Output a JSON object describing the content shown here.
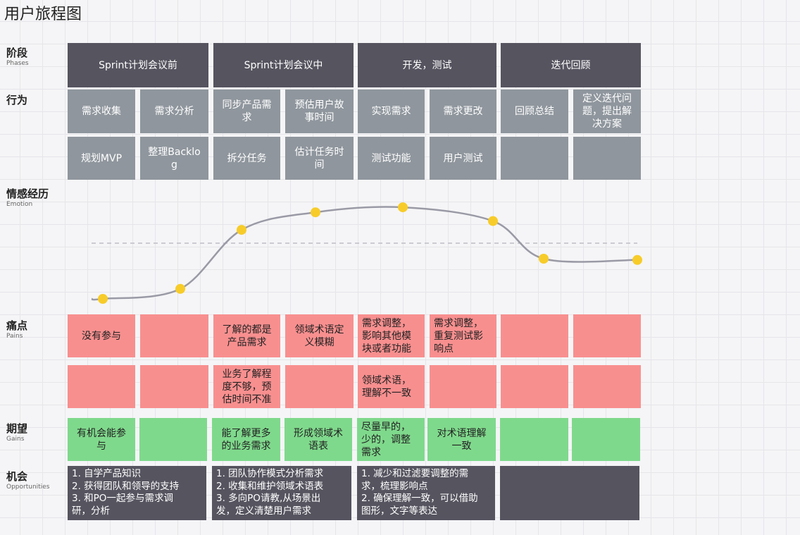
{
  "title": "用户旅程图",
  "rows": {
    "phases": {
      "label": "阶段",
      "sub": "Phases"
    },
    "actions": {
      "label": "行为",
      "sub": ""
    },
    "emotion": {
      "label": "情感经历",
      "sub": "Emotion"
    },
    "pains": {
      "label": "痛点",
      "sub": "Pains"
    },
    "gains": {
      "label": "期望",
      "sub": "Gains"
    },
    "opportunities": {
      "label": "机会",
      "sub": "Opportunities"
    }
  },
  "phases": [
    "Sprint计划会议前",
    "Sprint计划会议中",
    "开发，测试",
    "迭代回顾"
  ],
  "actions_row1": [
    "需求收集",
    "需求分析",
    "同步产品需\n求",
    "预估用户故\n事时间",
    "实现需求",
    "需求更改",
    "回顾总结",
    "定义迭代问\n题，提出解\n决方案"
  ],
  "actions_row2": [
    "规划MVP",
    "整理Backlo\ng",
    "拆分任务",
    "估计任务时\n间",
    "测试功能",
    "用户测试",
    "",
    ""
  ],
  "pains_row1": [
    "没有参与",
    "",
    "了解的都是\n产品需求",
    "领域术语定\n义模糊",
    "需求调整，\n影响其他模\n块或者功能",
    "需求调整，\n重复测试影\n响点",
    "",
    ""
  ],
  "pains_row2": [
    "",
    "",
    "业务了解程\n度不够，预\n估时间不准",
    "",
    "领域术语，\n理解不一致",
    "",
    "",
    ""
  ],
  "gains": [
    "有机会能参\n与",
    "",
    "能了解更多\n的业务需求",
    "形成领域术\n语表",
    "尽量早的，\n少的，调整\n需求",
    "对术语理解\n一致",
    "",
    ""
  ],
  "opportunities": [
    "1. 自学产品知识\n2. 获得团队和领导的支持\n3. 和PO一起参与需求调\n研，分析",
    "1. 团队协作模式分析需求\n2. 收集和维护领域术语表\n3. 多向PO请教,从场景出\n发，定义清楚用户需求",
    "1. 减少和过滤要调整的需\n求，梳理影响点\n2. 确保理解一致，可以借助\n图形，文字等表达",
    ""
  ],
  "emotion_level": [
    0.0,
    0.08,
    0.55,
    0.69,
    0.73,
    0.62,
    0.32,
    0.31
  ],
  "colors": {
    "phase": "#56545f",
    "action": "#8f969d",
    "pain": "#f88f8f",
    "gain": "#7fd98c",
    "dot": "#f7cc2a",
    "curve": "#9a9aa6"
  }
}
